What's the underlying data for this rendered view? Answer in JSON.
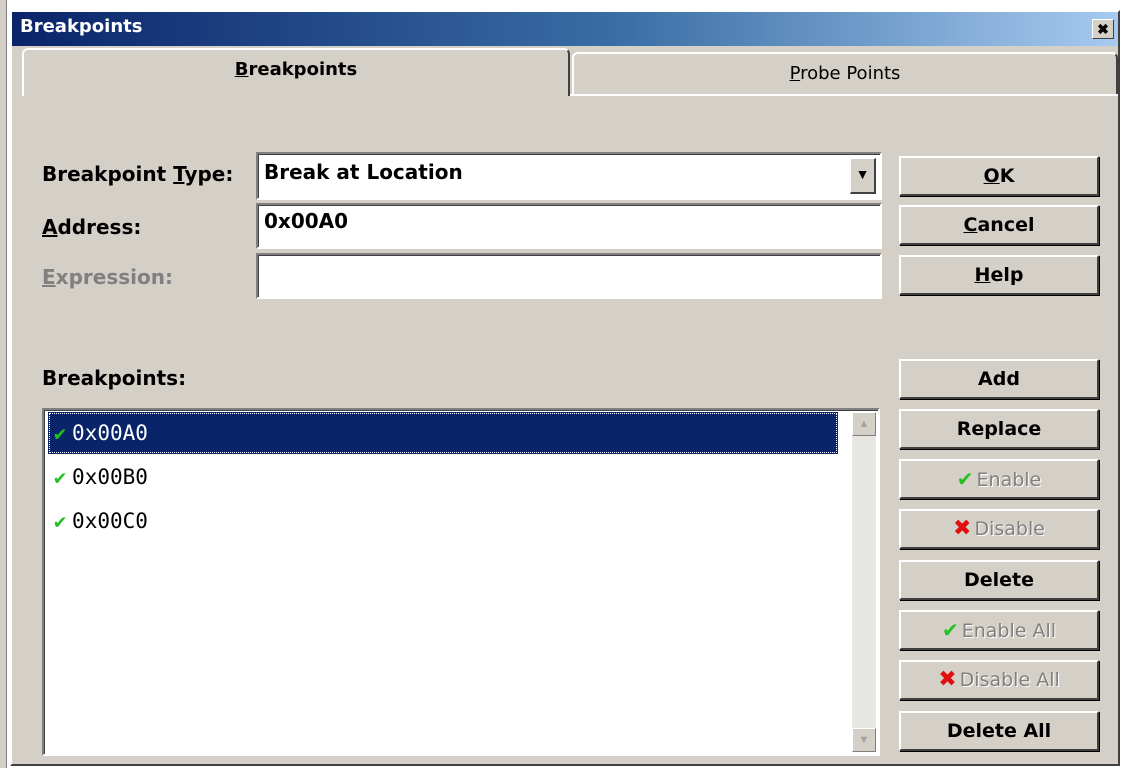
{
  "window": {
    "title": "Breakpoints",
    "close_glyph": "✕"
  },
  "tabs": [
    {
      "label_prefix": "",
      "label_access": "B",
      "label_rest": "reakpoints",
      "active": true
    },
    {
      "label_prefix": "",
      "label_access": "P",
      "label_rest": "robe Points",
      "active": false
    }
  ],
  "form": {
    "type_label_pre": "Breakpoint ",
    "type_label_access": "T",
    "type_label_post": "ype:",
    "type_value": "Break at Location",
    "address_label_access": "A",
    "address_label_post": "ddress:",
    "address_value": "0x00A0",
    "expression_label_access": "E",
    "expression_label_post": "xpression:",
    "expression_value": ""
  },
  "dialog_buttons": {
    "ok_access": "O",
    "ok_rest": "K",
    "cancel_access": "C",
    "cancel_rest": "ancel",
    "help_access": "H",
    "help_rest": "elp"
  },
  "list_label": "Breakpoints:",
  "breakpoints": [
    {
      "address": "0x00A0",
      "enabled": true,
      "selected": true
    },
    {
      "address": "0x00B0",
      "enabled": true,
      "selected": false
    },
    {
      "address": "0x00C0",
      "enabled": true,
      "selected": false
    }
  ],
  "list_buttons": {
    "add": "Add",
    "replace": "Replace",
    "enable": "Enable",
    "disable": "Disable",
    "delete": "Delete",
    "enable_all": "Enable All",
    "disable_all": "Disable All",
    "delete_all": "Delete All"
  },
  "icons": {
    "check": "✔",
    "cross": "✖",
    "dropdown": "▼",
    "scroll_up": "▲",
    "scroll_down": "▼"
  },
  "colors": {
    "selection": "#0a246a",
    "check": "#22c022",
    "cross": "#e01010",
    "face": "#d4d0c8"
  }
}
